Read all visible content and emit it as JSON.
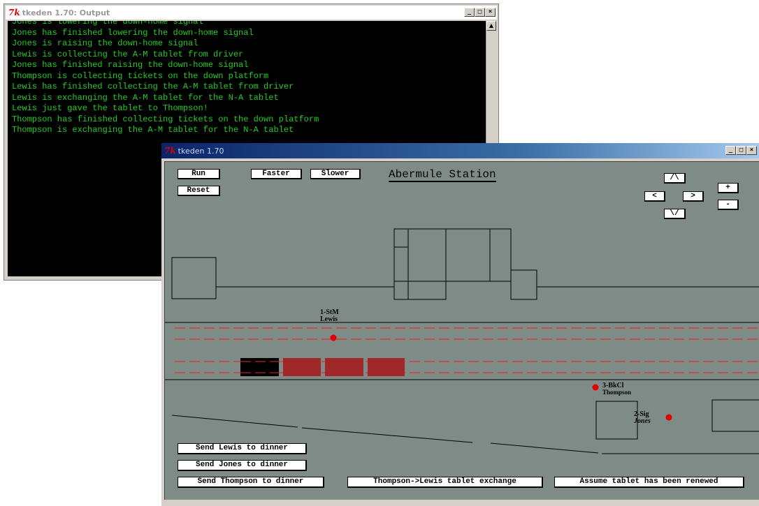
{
  "output_window": {
    "title": "tkeden 1.70: Output",
    "logo": "7k",
    "lines": [
      "Jones is lowering the down-home signal",
      "Jones has finished lowering the down-home signal",
      "Jones is raising the down-home signal",
      "Lewis is collecting the A-M tablet from driver",
      "Jones has finished raising the down-home signal",
      "Thompson is collecting tickets on the down platform",
      "Lewis has finished collecting the A-M tablet from driver",
      "Lewis is exchanging the A-M tablet for the N-A tablet",
      "Lewis just gave the tablet to Thompson!",
      "Thompson has finished collecting tickets on the down platform",
      "Thompson is exchanging the A-M tablet for the N-A tablet"
    ],
    "scroll_up": "▲",
    "controls": {
      "minimize": "_",
      "maximize": "□",
      "close": "×"
    }
  },
  "main_window": {
    "title": "tkeden 1.70",
    "logo": "7k",
    "controls": {
      "minimize": "_",
      "maximize": "□",
      "close": "×"
    }
  },
  "station": {
    "title": "Abermule Station",
    "buttons": {
      "run": "Run",
      "reset": "Reset",
      "faster": "Faster",
      "slower": "Slower",
      "up": "/\\",
      "left": "<",
      "right": ">",
      "down": "\\/",
      "zoom_in": "+",
      "zoom_out": "-",
      "send_lewis": "Send Lewis to dinner",
      "send_jones": "Send Jones to dinner",
      "send_thompson": "Send Thompson to dinner",
      "tablet_exchange": "Thompson->Lewis tablet exchange",
      "assume_renewed": "Assume tablet has been renewed"
    },
    "labels": {
      "lewis_code": "1-StM",
      "lewis_name": "Lewis",
      "thompson_code": "3-BkCl",
      "thompson_name": "Thompson",
      "jones_code": "2-Sig",
      "jones_name": "Jones"
    },
    "colors": {
      "background": "#7f8b87",
      "rail_dash": "#e03030",
      "carriage": "#a02828",
      "locomotive": "#000000",
      "person_marker": "#e00000",
      "console_text": "#22cc22"
    }
  }
}
